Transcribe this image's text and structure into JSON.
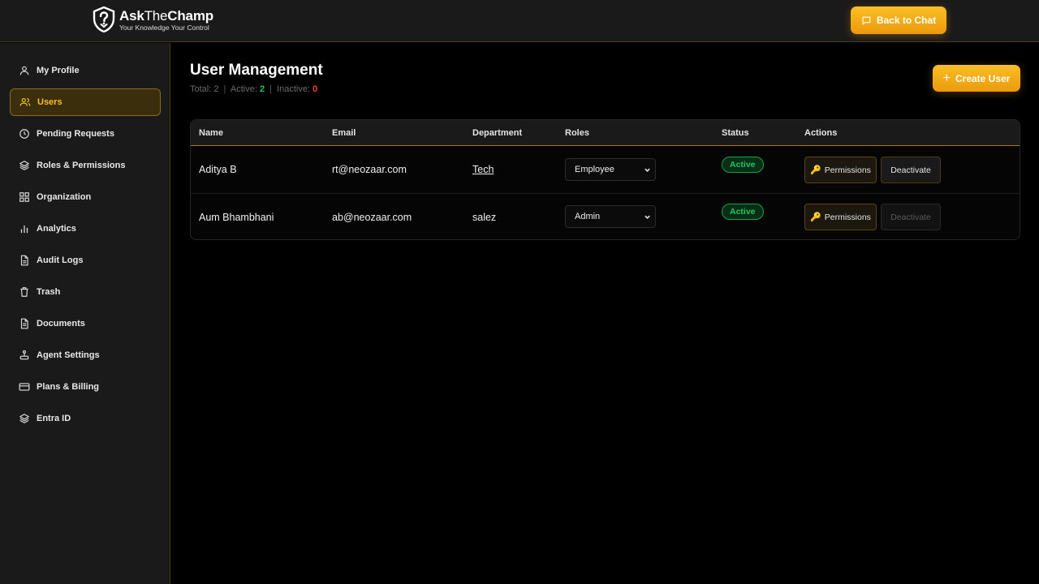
{
  "brand": {
    "name_bold": "Ask",
    "name_thin": "The",
    "name_end": "Champ",
    "tagline": "Your Knowledge Your Control"
  },
  "header": {
    "back_label": "Back to Chat",
    "accent": "#f59e0b"
  },
  "sidebar": {
    "items": [
      {
        "label": "My Profile",
        "icon": "user-icon"
      },
      {
        "label": "Users",
        "icon": "users-icon",
        "active": true
      },
      {
        "label": "Pending Requests",
        "icon": "clock-icon"
      },
      {
        "label": "Roles & Permissions",
        "icon": "layers-icon"
      },
      {
        "label": "Organization",
        "icon": "grid-icon"
      },
      {
        "label": "Analytics",
        "icon": "bar-chart-icon"
      },
      {
        "label": "Audit Logs",
        "icon": "file-text-icon"
      },
      {
        "label": "Trash",
        "icon": "trash-icon"
      },
      {
        "label": "Documents",
        "icon": "document-icon"
      },
      {
        "label": "Agent Settings",
        "icon": "joystick-icon"
      },
      {
        "label": "Plans & Billing",
        "icon": "credit-card-icon"
      },
      {
        "label": "Entra ID",
        "icon": "layers-icon"
      }
    ]
  },
  "main": {
    "title": "User Management",
    "stats": {
      "total_label": "Total:",
      "total": "2",
      "active_label": "Active:",
      "active": "2",
      "inactive_label": "Inactive:",
      "inactive": "0"
    },
    "create_label": "Create User",
    "table": {
      "headers": [
        "Name",
        "Email",
        "Department",
        "Roles",
        "Status",
        "Actions"
      ],
      "rows": [
        {
          "name": "Aditya B",
          "email": "rt@neozaar.com",
          "department": "Tech",
          "role": "Employee",
          "status": "Active",
          "permissions_label": "Permissions",
          "deactivate_label": "Deactivate",
          "deactivate_enabled": true
        },
        {
          "name": "Aum Bhambhani",
          "email": "ab@neozaar.com",
          "department": "salez",
          "role": "Admin",
          "status": "Active",
          "permissions_label": "Permissions",
          "deactivate_label": "Deactivate",
          "deactivate_enabled": false
        }
      ]
    }
  },
  "colors": {
    "status_active": "#22c55e",
    "inactive_count": "#ef4444"
  }
}
